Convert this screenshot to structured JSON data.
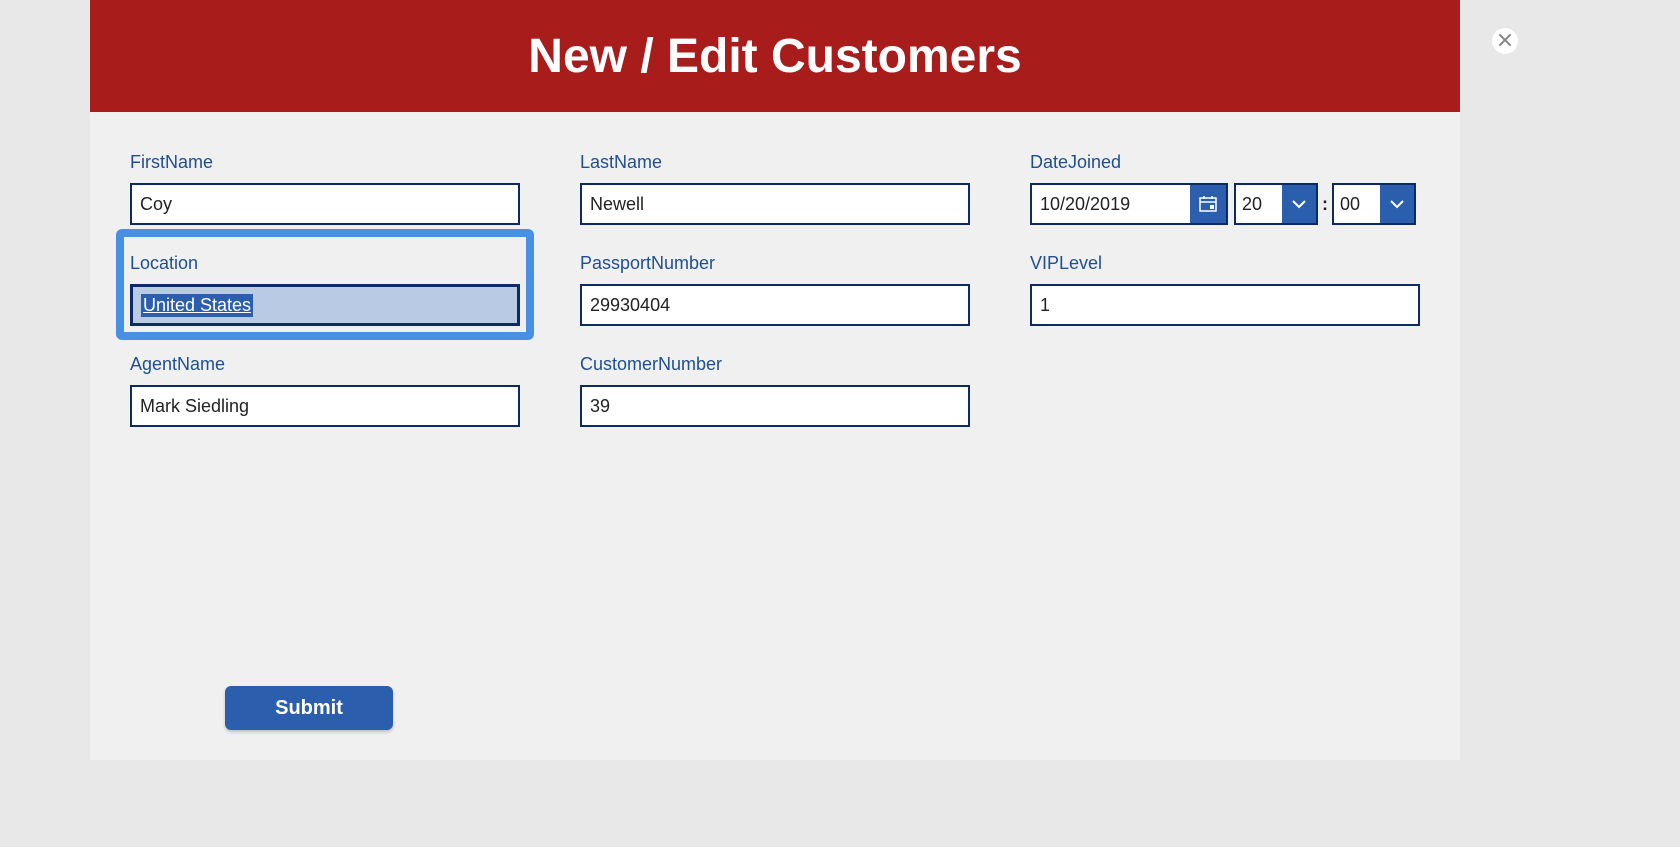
{
  "header": {
    "title": "New / Edit Customers"
  },
  "fields": {
    "firstName": {
      "label": "FirstName",
      "value": "Coy"
    },
    "lastName": {
      "label": "LastName",
      "value": "Newell"
    },
    "dateJoined": {
      "label": "DateJoined",
      "date": "10/20/2019",
      "hour": "20",
      "minute": "00"
    },
    "location": {
      "label": "Location",
      "value": "United States"
    },
    "passportNumber": {
      "label": "PassportNumber",
      "value": "29930404"
    },
    "vipLevel": {
      "label": "VIPLevel",
      "value": "1"
    },
    "agentName": {
      "label": "AgentName",
      "value": "Mark Siedling"
    },
    "customerNumber": {
      "label": "CustomerNumber",
      "value": "39"
    }
  },
  "buttons": {
    "submit": "Submit"
  },
  "timeSeparator": ":"
}
